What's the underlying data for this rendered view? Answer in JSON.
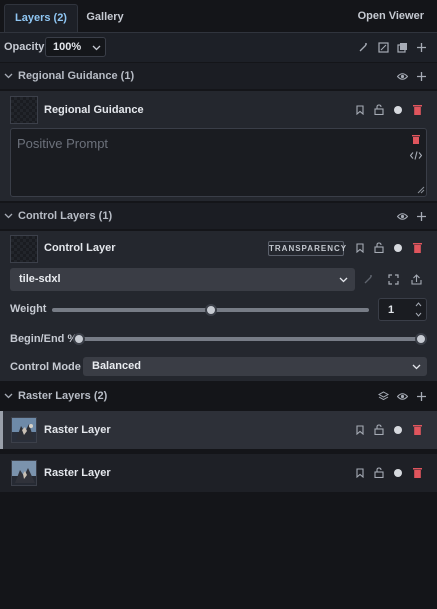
{
  "tabs": {
    "layers": "Layers (2)",
    "gallery": "Gallery",
    "open_viewer": "Open Viewer"
  },
  "opacity": {
    "label": "Opacity",
    "value": "100%"
  },
  "regional": {
    "section_title": "Regional Guidance (1)",
    "layer_name": "Regional Guidance",
    "prompt_placeholder": "Positive Prompt"
  },
  "control": {
    "section_title": "Control Layers (1)",
    "layer_name": "Control Layer",
    "badge": "TRANSPARENCY",
    "model": "tile-sdxl",
    "weight_label": "Weight",
    "weight_value": "1",
    "weight_fraction": 0.5,
    "begin_end_label": "Begin/End %",
    "begin_fraction": 0.0,
    "end_fraction": 1.0,
    "mode_label": "Control Mode",
    "mode_value": "Balanced"
  },
  "raster": {
    "section_title": "Raster Layers (2)",
    "layers": [
      "Raster Layer",
      "Raster Layer"
    ]
  },
  "colors": {
    "accent": "#8fc6f3",
    "delete": "#e0555d",
    "background": "#141519",
    "panel": "#24272e"
  },
  "icons": [
    "bookmark-icon",
    "unlock-icon",
    "circle-dot-icon",
    "trash-icon",
    "eye-icon",
    "plus-icon",
    "code-icon",
    "layers-icon",
    "chevron-down-icon"
  ]
}
